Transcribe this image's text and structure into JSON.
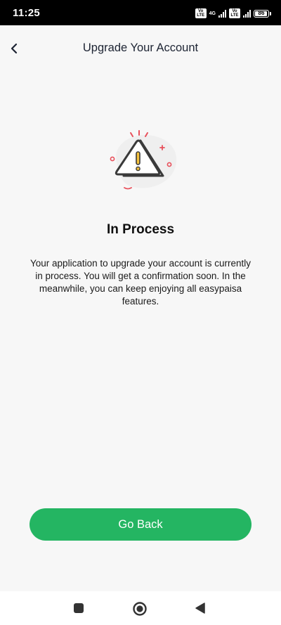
{
  "status_bar": {
    "time": "11:25",
    "sim1_label": "Vo LTE",
    "network_label": "4G",
    "sim2_label": "Vo LTE",
    "battery_level": "86",
    "battery_fraction": 0.86
  },
  "header": {
    "title": "Upgrade Your Account",
    "back_icon": "chevron-left-icon"
  },
  "main": {
    "illustration_icon": "warning-triangle-icon",
    "heading": "In Process",
    "description": "Your application to upgrade your account is currently in process. You will get a confirmation soon. In the meanwhile, you can keep enjoying all easypaisa features."
  },
  "actions": {
    "go_back_label": "Go Back"
  },
  "nav_bar": {
    "recent_icon": "square-icon",
    "home_icon": "circle-icon",
    "back_icon": "triangle-back-icon"
  },
  "colors": {
    "accent": "#24b562",
    "warning_accent": "#e8505b",
    "icon_yellow": "#f5c23e",
    "background": "#f7f7f7"
  }
}
